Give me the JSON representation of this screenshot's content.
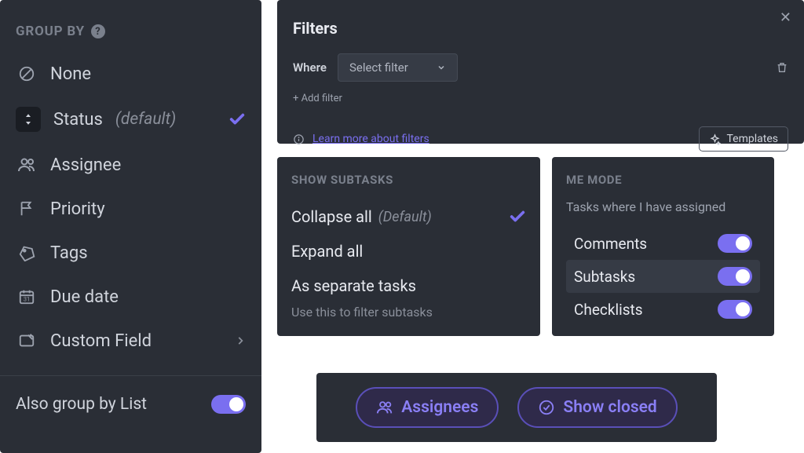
{
  "sidebar": {
    "header": "GROUP BY",
    "items": [
      {
        "label": "None",
        "icon": "none-icon"
      },
      {
        "label": "Status",
        "icon": "status-icon",
        "default_tag": "(default)",
        "selected": true
      },
      {
        "label": "Assignee",
        "icon": "assignee-icon"
      },
      {
        "label": "Priority",
        "icon": "priority-icon"
      },
      {
        "label": "Tags",
        "icon": "tags-icon"
      },
      {
        "label": "Due date",
        "icon": "duedate-icon"
      },
      {
        "label": "Custom Field",
        "icon": "customfield-icon",
        "chevron": true
      }
    ],
    "also_group_label": "Also group by List",
    "also_group_on": true
  },
  "filters": {
    "title": "Filters",
    "where_label": "Where",
    "select_placeholder": "Select filter",
    "add_filter": "+ Add filter",
    "learn_link": "Learn more about filters",
    "templates_btn": "Templates"
  },
  "subtasks": {
    "header": "SHOW SUBTASKS",
    "items": [
      {
        "label": "Collapse all",
        "default_tag": "(Default)",
        "selected": true
      },
      {
        "label": "Expand all"
      },
      {
        "label": "As separate tasks"
      }
    ],
    "help": "Use this to filter subtasks"
  },
  "memode": {
    "header": "ME MODE",
    "desc": "Tasks where I have assigned",
    "rows": [
      {
        "label": "Comments",
        "on": true
      },
      {
        "label": "Subtasks",
        "on": true,
        "highlight": true
      },
      {
        "label": "Checklists",
        "on": true
      }
    ]
  },
  "bottom": {
    "assignees": "Assignees",
    "show_closed": "Show closed"
  }
}
